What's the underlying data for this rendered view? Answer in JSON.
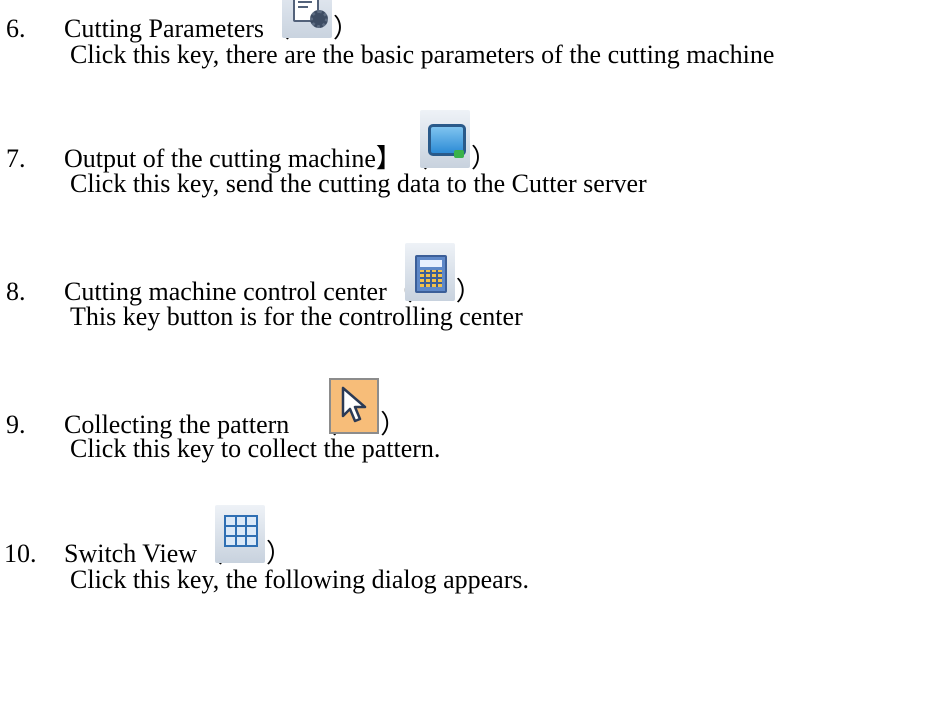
{
  "items": [
    {
      "number": "6.",
      "title": "Cutting Parameters",
      "open_paren": "（",
      "close_paren": "）",
      "icon": "document-gear-icon",
      "description": "Click this key, there are the basic parameters of the cutting machine"
    },
    {
      "number": "7.",
      "title": "Output of the cutting machine】",
      "open_paren": "（",
      "close_paren": "）",
      "icon": "monitor-icon",
      "description": "Click this key, send the cutting data to the Cutter server"
    },
    {
      "number": "8.",
      "title": "Cutting machine control center",
      "open_paren": "（",
      "close_paren": "）",
      "icon": "calculator-icon",
      "description": "This key button is for the controlling center"
    },
    {
      "number": "9.",
      "title": "Collecting the pattern",
      "open_paren": "（",
      "close_paren": "）",
      "icon": "cursor-arrow-icon",
      "description": "Click this key to collect the pattern."
    },
    {
      "number": "10.",
      "title": "Switch View",
      "open_paren": "（",
      "close_paren": "）",
      "icon": "grid-view-icon",
      "description": "Click this key, the following dialog appears."
    }
  ]
}
